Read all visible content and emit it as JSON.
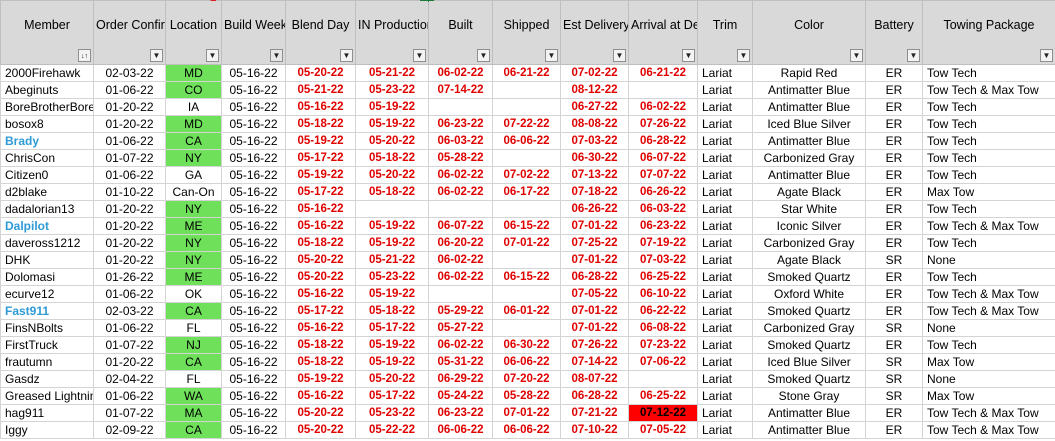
{
  "columns": [
    {
      "label": "Member",
      "filter": "sort"
    },
    {
      "label": "Order Confirm Date",
      "filter": "dropdown"
    },
    {
      "label": "Location",
      "filter": "dropdown"
    },
    {
      "label": "Build Week",
      "filter": "filter-active"
    },
    {
      "label": "Blend Day",
      "filter": "dropdown"
    },
    {
      "label": "IN Production",
      "filter": "dropdown"
    },
    {
      "label": "Built",
      "filter": "dropdown"
    },
    {
      "label": "Shipped",
      "filter": "dropdown"
    },
    {
      "label": "Est Delivery Date",
      "filter": "dropdown"
    },
    {
      "label": "Arrival at Dealer",
      "filter": "dropdown"
    },
    {
      "label": "Trim",
      "filter": "dropdown"
    },
    {
      "label": "Color",
      "filter": "dropdown"
    },
    {
      "label": "Battery",
      "filter": "dropdown"
    },
    {
      "label": "Towing Package",
      "filter": "dropdown"
    }
  ],
  "colors": {
    "green_cell": "#6ee05a",
    "red_text": "#e00000",
    "blue_member": "#2e9bd6",
    "header_bg": "#d9d9d9",
    "alert_cell": "#ff0000"
  },
  "rows": [
    {
      "member": "2000Firehawk",
      "order": "02-03-22",
      "loc": "MD",
      "loc_green": true,
      "build": "05-16-22",
      "blend": "05-20-22",
      "inprod": "05-21-22",
      "built": "06-02-22",
      "shipped": "06-21-22",
      "est": "07-02-22",
      "arrival": "06-21-22",
      "trim": "Lariat",
      "color": "Rapid Red",
      "battery": "ER",
      "tow": "Tow Tech"
    },
    {
      "member": "Abeginuts",
      "order": "01-06-22",
      "loc": "CO",
      "loc_green": true,
      "build": "05-16-22",
      "blend": "05-21-22",
      "inprod": "05-23-22",
      "built": "07-14-22",
      "shipped": "",
      "est": "08-12-22",
      "arrival": "",
      "trim": "Lariat",
      "color": "Antimatter Blue",
      "battery": "ER",
      "tow": "Tow Tech & Max Tow"
    },
    {
      "member": "BoreBrotherBore",
      "order": "01-20-22",
      "loc": "IA",
      "build": "05-16-22",
      "blend": "05-16-22",
      "inprod": "05-19-22",
      "built": "",
      "shipped": "",
      "est": "06-27-22",
      "arrival": "06-02-22",
      "trim": "Lariat",
      "color": "Antimatter Blue",
      "battery": "ER",
      "tow": "Tow Tech"
    },
    {
      "member": "bosox8",
      "order": "01-20-22",
      "loc": "MD",
      "loc_green": true,
      "build": "05-16-22",
      "blend": "05-18-22",
      "inprod": "05-19-22",
      "built": "06-23-22",
      "shipped": "07-22-22",
      "est": "08-08-22",
      "arrival": "07-26-22",
      "trim": "Lariat",
      "color": "Iced Blue Silver",
      "battery": "ER",
      "tow": "Tow Tech"
    },
    {
      "member": "Brady",
      "member_blue": true,
      "order": "01-06-22",
      "loc": "CA",
      "loc_green": true,
      "build": "05-16-22",
      "blend": "05-19-22",
      "inprod": "05-20-22",
      "built": "06-03-22",
      "shipped": "06-06-22",
      "est": "07-03-22",
      "arrival": "06-28-22",
      "trim": "Lariat",
      "color": "Antimatter Blue",
      "battery": "ER",
      "tow": "Tow Tech"
    },
    {
      "member": "ChrisCon",
      "order": "01-07-22",
      "loc": "NY",
      "loc_green": true,
      "build": "05-16-22",
      "blend": "05-17-22",
      "inprod": "05-18-22",
      "built": "05-28-22",
      "shipped": "",
      "est": "06-30-22",
      "arrival": "06-07-22",
      "trim": "Lariat",
      "color": "Carbonized Gray",
      "battery": "ER",
      "tow": "Tow Tech"
    },
    {
      "member": "Citizen0",
      "order": "01-06-22",
      "loc": "GA",
      "build": "05-16-22",
      "blend": "05-19-22",
      "inprod": "05-20-22",
      "built": "06-02-22",
      "shipped": "07-02-22",
      "est": "07-13-22",
      "arrival": "07-07-22",
      "trim": "Lariat",
      "color": "Antimatter Blue",
      "battery": "ER",
      "tow": "Tow Tech"
    },
    {
      "member": "d2blake",
      "order": "01-10-22",
      "loc": "Can-On",
      "build": "05-16-22",
      "blend": "05-17-22",
      "inprod": "05-18-22",
      "built": "06-02-22",
      "shipped": "06-17-22",
      "est": "07-18-22",
      "arrival": "06-26-22",
      "trim": "Lariat",
      "color": "Agate Black",
      "battery": "ER",
      "tow": "Max Tow"
    },
    {
      "member": "dadalorian13",
      "order": "01-20-22",
      "loc": "NY",
      "loc_green": true,
      "build": "05-16-22",
      "blend": "05-16-22",
      "inprod": "",
      "built": "",
      "shipped": "",
      "est": "06-26-22",
      "arrival": "06-03-22",
      "trim": "Lariat",
      "color": "Star White",
      "battery": "ER",
      "tow": "Tow Tech"
    },
    {
      "member": "Dalpilot",
      "member_blue": true,
      "order": "01-20-22",
      "loc": "ME",
      "loc_green": true,
      "build": "05-16-22",
      "blend": "05-16-22",
      "inprod": "05-19-22",
      "built": "06-07-22",
      "shipped": "06-15-22",
      "est": "07-01-22",
      "arrival": "06-23-22",
      "trim": "Lariat",
      "color": "Iconic Silver",
      "battery": "ER",
      "tow": "Tow Tech & Max Tow"
    },
    {
      "member": "daveross1212",
      "order": "01-20-22",
      "loc": "NY",
      "loc_green": true,
      "build": "05-16-22",
      "blend": "05-18-22",
      "inprod": "05-19-22",
      "built": "06-20-22",
      "shipped": "07-01-22",
      "est": "07-25-22",
      "arrival": "07-19-22",
      "trim": "Lariat",
      "color": "Carbonized Gray",
      "battery": "ER",
      "tow": "Tow Tech"
    },
    {
      "member": "DHK",
      "order": "01-20-22",
      "loc": "NY",
      "loc_green": true,
      "build": "05-16-22",
      "blend": "05-20-22",
      "inprod": "05-21-22",
      "built": "06-02-22",
      "shipped": "",
      "est": "07-01-22",
      "arrival": "07-03-22",
      "trim": "Lariat",
      "color": "Agate Black",
      "battery": "SR",
      "tow": "None"
    },
    {
      "member": "Dolomasi",
      "order": "01-26-22",
      "loc": "ME",
      "loc_green": true,
      "build": "05-16-22",
      "blend": "05-20-22",
      "inprod": "05-23-22",
      "built": "06-02-22",
      "shipped": "06-15-22",
      "est": "06-28-22",
      "arrival": "06-25-22",
      "trim": "Lariat",
      "color": "Smoked Quartz",
      "battery": "ER",
      "tow": "Tow Tech"
    },
    {
      "member": "ecurve12",
      "order": "01-06-22",
      "loc": "OK",
      "build": "05-16-22",
      "blend": "05-16-22",
      "inprod": "05-19-22",
      "built": "",
      "shipped": "",
      "est": "07-05-22",
      "arrival": "06-10-22",
      "trim": "Lariat",
      "color": "Oxford White",
      "battery": "ER",
      "tow": "Tow Tech & Max Tow"
    },
    {
      "member": "Fast911",
      "member_blue": true,
      "order": "02-03-22",
      "loc": "CA",
      "loc_green": true,
      "build": "05-16-22",
      "blend": "05-17-22",
      "inprod": "05-18-22",
      "built": "05-29-22",
      "shipped": "06-01-22",
      "est": "07-01-22",
      "arrival": "06-22-22",
      "trim": "Lariat",
      "color": "Smoked Quartz",
      "battery": "ER",
      "tow": "Tow Tech & Max Tow"
    },
    {
      "member": "FinsNBolts",
      "order": "01-06-22",
      "loc": "FL",
      "build": "05-16-22",
      "blend": "05-16-22",
      "inprod": "05-17-22",
      "built": "05-27-22",
      "shipped": "",
      "est": "07-01-22",
      "arrival": "06-08-22",
      "trim": "Lariat",
      "color": "Carbonized Gray",
      "battery": "SR",
      "tow": "None"
    },
    {
      "member": "FirstTruck",
      "order": "01-07-22",
      "loc": "NJ",
      "loc_green": true,
      "build": "05-16-22",
      "blend": "05-18-22",
      "inprod": "05-19-22",
      "built": "06-02-22",
      "shipped": "06-30-22",
      "est": "07-26-22",
      "arrival": "07-23-22",
      "trim": "Lariat",
      "color": "Smoked Quartz",
      "battery": "ER",
      "tow": "Tow Tech"
    },
    {
      "member": "frautumn",
      "order": "01-20-22",
      "loc": "CA",
      "loc_green": true,
      "build": "05-16-22",
      "blend": "05-18-22",
      "inprod": "05-19-22",
      "built": "05-31-22",
      "shipped": "06-06-22",
      "est": "07-14-22",
      "arrival": "07-06-22",
      "trim": "Lariat",
      "color": "Iced Blue Silver",
      "battery": "SR",
      "tow": "Max Tow"
    },
    {
      "member": "Gasdz",
      "order": "02-04-22",
      "loc": "FL",
      "build": "05-16-22",
      "blend": "05-19-22",
      "inprod": "05-20-22",
      "built": "06-29-22",
      "shipped": "07-20-22",
      "est": "08-07-22",
      "arrival": "",
      "trim": "Lariat",
      "color": "Smoked Quartz",
      "battery": "SR",
      "tow": "None"
    },
    {
      "member": "Greased Lightning",
      "order": "01-06-22",
      "loc": "WA",
      "loc_green": true,
      "build": "05-16-22",
      "blend": "05-16-22",
      "inprod": "05-17-22",
      "built": "05-24-22",
      "shipped": "05-28-22",
      "est": "06-28-22",
      "arrival": "06-25-22",
      "trim": "Lariat",
      "color": "Stone Gray",
      "battery": "SR",
      "tow": "Max Tow"
    },
    {
      "member": "hag911",
      "order": "01-07-22",
      "loc": "MA",
      "loc_green": true,
      "build": "05-16-22",
      "blend": "05-20-22",
      "inprod": "05-23-22",
      "built": "06-23-22",
      "shipped": "07-01-22",
      "est": "07-21-22",
      "arrival": "07-12-22",
      "arrival_alert": true,
      "trim": "Lariat",
      "color": "Antimatter Blue",
      "battery": "ER",
      "tow": "Tow Tech & Max Tow"
    },
    {
      "member": "Iggy",
      "order": "02-09-22",
      "loc": "CA",
      "loc_green": true,
      "build": "05-16-22",
      "blend": "05-20-22",
      "inprod": "05-22-22",
      "built": "06-06-22",
      "shipped": "06-06-22",
      "est": "07-10-22",
      "arrival": "07-05-22",
      "trim": "Lariat",
      "color": "Antimatter Blue",
      "battery": "ER",
      "tow": "Tow Tech & Max Tow"
    }
  ]
}
